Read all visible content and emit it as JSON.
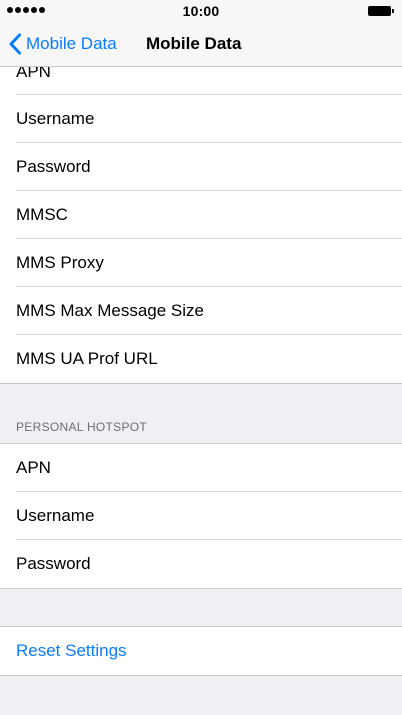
{
  "status_bar": {
    "time": "10:00",
    "signal_icon": "signal-dots-icon",
    "battery_icon": "battery-icon"
  },
  "nav": {
    "back_label": "Mobile Data",
    "title": "Mobile Data"
  },
  "mobile_data_section": {
    "items": [
      {
        "label": "APN"
      },
      {
        "label": "Username"
      },
      {
        "label": "Password"
      },
      {
        "label": "MMSC"
      },
      {
        "label": "MMS Proxy"
      },
      {
        "label": "MMS Max Message Size"
      },
      {
        "label": "MMS UA Prof URL"
      }
    ]
  },
  "personal_hotspot_section": {
    "header": "PERSONAL HOTSPOT",
    "items": [
      {
        "label": "APN"
      },
      {
        "label": "Username"
      },
      {
        "label": "Password"
      }
    ]
  },
  "reset": {
    "label": "Reset Settings"
  },
  "colors": {
    "accent": "#0a7cff",
    "background": "#efeff4",
    "separator": "#d9d9de"
  }
}
